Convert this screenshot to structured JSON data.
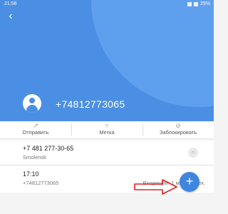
{
  "status_bar": {
    "time": "21:56",
    "battery": "25%"
  },
  "contact": {
    "phone_number": "+74812773065"
  },
  "actions": [
    {
      "icon": "share-icon",
      "label": "Отправить"
    },
    {
      "icon": "bookmark-icon",
      "label": "Метка"
    },
    {
      "icon": "block-icon",
      "label": "Заблокировать"
    }
  ],
  "number_card": {
    "number": "+7 481 277-30-65",
    "location": "Smolensk"
  },
  "call_log": {
    "time": "17:10",
    "number": "+74812773065",
    "detail": "Входящий: 1 мин. 19 сек."
  },
  "fab": {
    "symbol": "+"
  },
  "colors": {
    "header": "#4a8fe4",
    "accent": "#3f86e0",
    "annotation_arrow": "#e02020"
  }
}
